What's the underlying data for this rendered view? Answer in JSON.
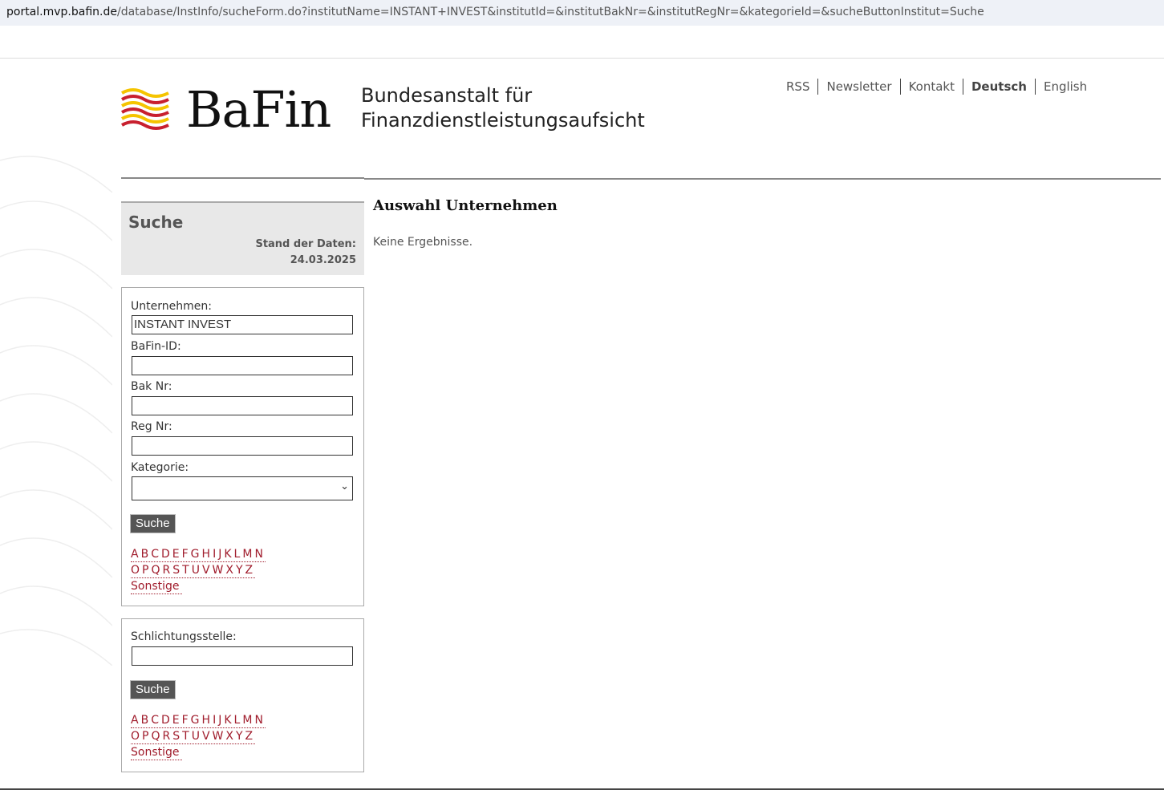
{
  "browser": {
    "url_host": "portal.mvp.bafin.de",
    "url_path": "/database/InstInfo/sucheForm.do?institutName=INSTANT+INVEST&institutId=&institutBakNr=&institutRegNr=&kategorieId=&sucheButtonInstitut=Suche"
  },
  "header": {
    "logo_text": "BaFin",
    "subtitle_line1": "Bundesanstalt für",
    "subtitle_line2": "Finanzdienstleistungsaufsicht",
    "nav": [
      "RSS",
      "Newsletter",
      "Kontakt",
      "Deutsch",
      "English"
    ]
  },
  "sidebar": {
    "title": "Suche",
    "stand_label": "Stand der Daten:",
    "stand_date": "24.03.2025",
    "form1": {
      "company_label": "Unternehmen:",
      "company_value": "INSTANT INVEST",
      "bafin_id_label": "BaFin-ID:",
      "bafin_id_value": "",
      "bak_label": "Bak Nr:",
      "bak_value": "",
      "reg_label": "Reg Nr:",
      "reg_value": "",
      "kategorie_label": "Kategorie:",
      "kategorie_value": "",
      "search_button": "Suche"
    },
    "form2": {
      "label": "Schlichtungsstelle:",
      "value": "",
      "search_button": "Suche"
    },
    "letters_row1": [
      "A",
      "B",
      "C",
      "D",
      "E",
      "F",
      "G",
      "H",
      "I",
      "J",
      "K",
      "L",
      "M",
      "N"
    ],
    "letters_row2": [
      "O",
      "P",
      "Q",
      "R",
      "S",
      "T",
      "U",
      "V",
      "W",
      "X",
      "Y",
      "Z"
    ],
    "other_link": "Sonstige"
  },
  "main": {
    "title": "Auswahl Unternehmen",
    "message": "Keine Ergebnisse."
  },
  "colors": {
    "accent": "#a01c2c",
    "logo_red": "#c8202f",
    "logo_yellow": "#f5c400"
  }
}
